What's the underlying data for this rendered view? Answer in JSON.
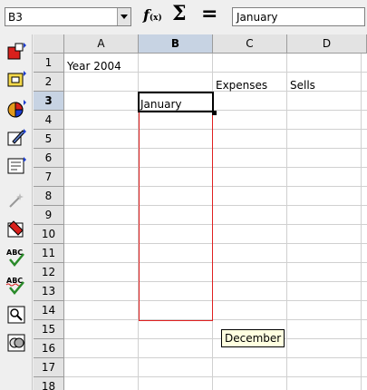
{
  "formula_bar": {
    "name_box": "B3",
    "function_wizard_label": "f",
    "function_wizard_sub": "(x)",
    "sum_label": "Σ",
    "equals_label": "=",
    "input_value": "January"
  },
  "toolbar": {
    "tools": [
      "insert-icon",
      "insert-cell-icon",
      "chart-icon",
      "draw-functions-icon",
      "form-controls-icon",
      "autopilot-icon",
      "cell-format-icon",
      "spellcheck-icon",
      "autospellcheck-icon",
      "find-icon",
      "navigator-icon"
    ]
  },
  "sheet": {
    "columns": [
      "A",
      "B",
      "C",
      "D"
    ],
    "selected_column": "B",
    "rows": [
      "1",
      "2",
      "3",
      "4",
      "5",
      "6",
      "7",
      "8",
      "9",
      "10",
      "11",
      "12",
      "13",
      "14",
      "15",
      "16",
      "17",
      "18"
    ],
    "selected_row": "3",
    "cells": {
      "A1": "Year 2004",
      "C2": "Expenses",
      "D2": "Sells",
      "B3": "January"
    },
    "active_cell": "B3"
  },
  "autofill_tooltip": "December",
  "colors": {
    "header_bg": "#e3e3e3",
    "header_selected_bg": "#c7d3e3",
    "fill_border": "#e02020",
    "tooltip_bg": "#ffffe0"
  }
}
